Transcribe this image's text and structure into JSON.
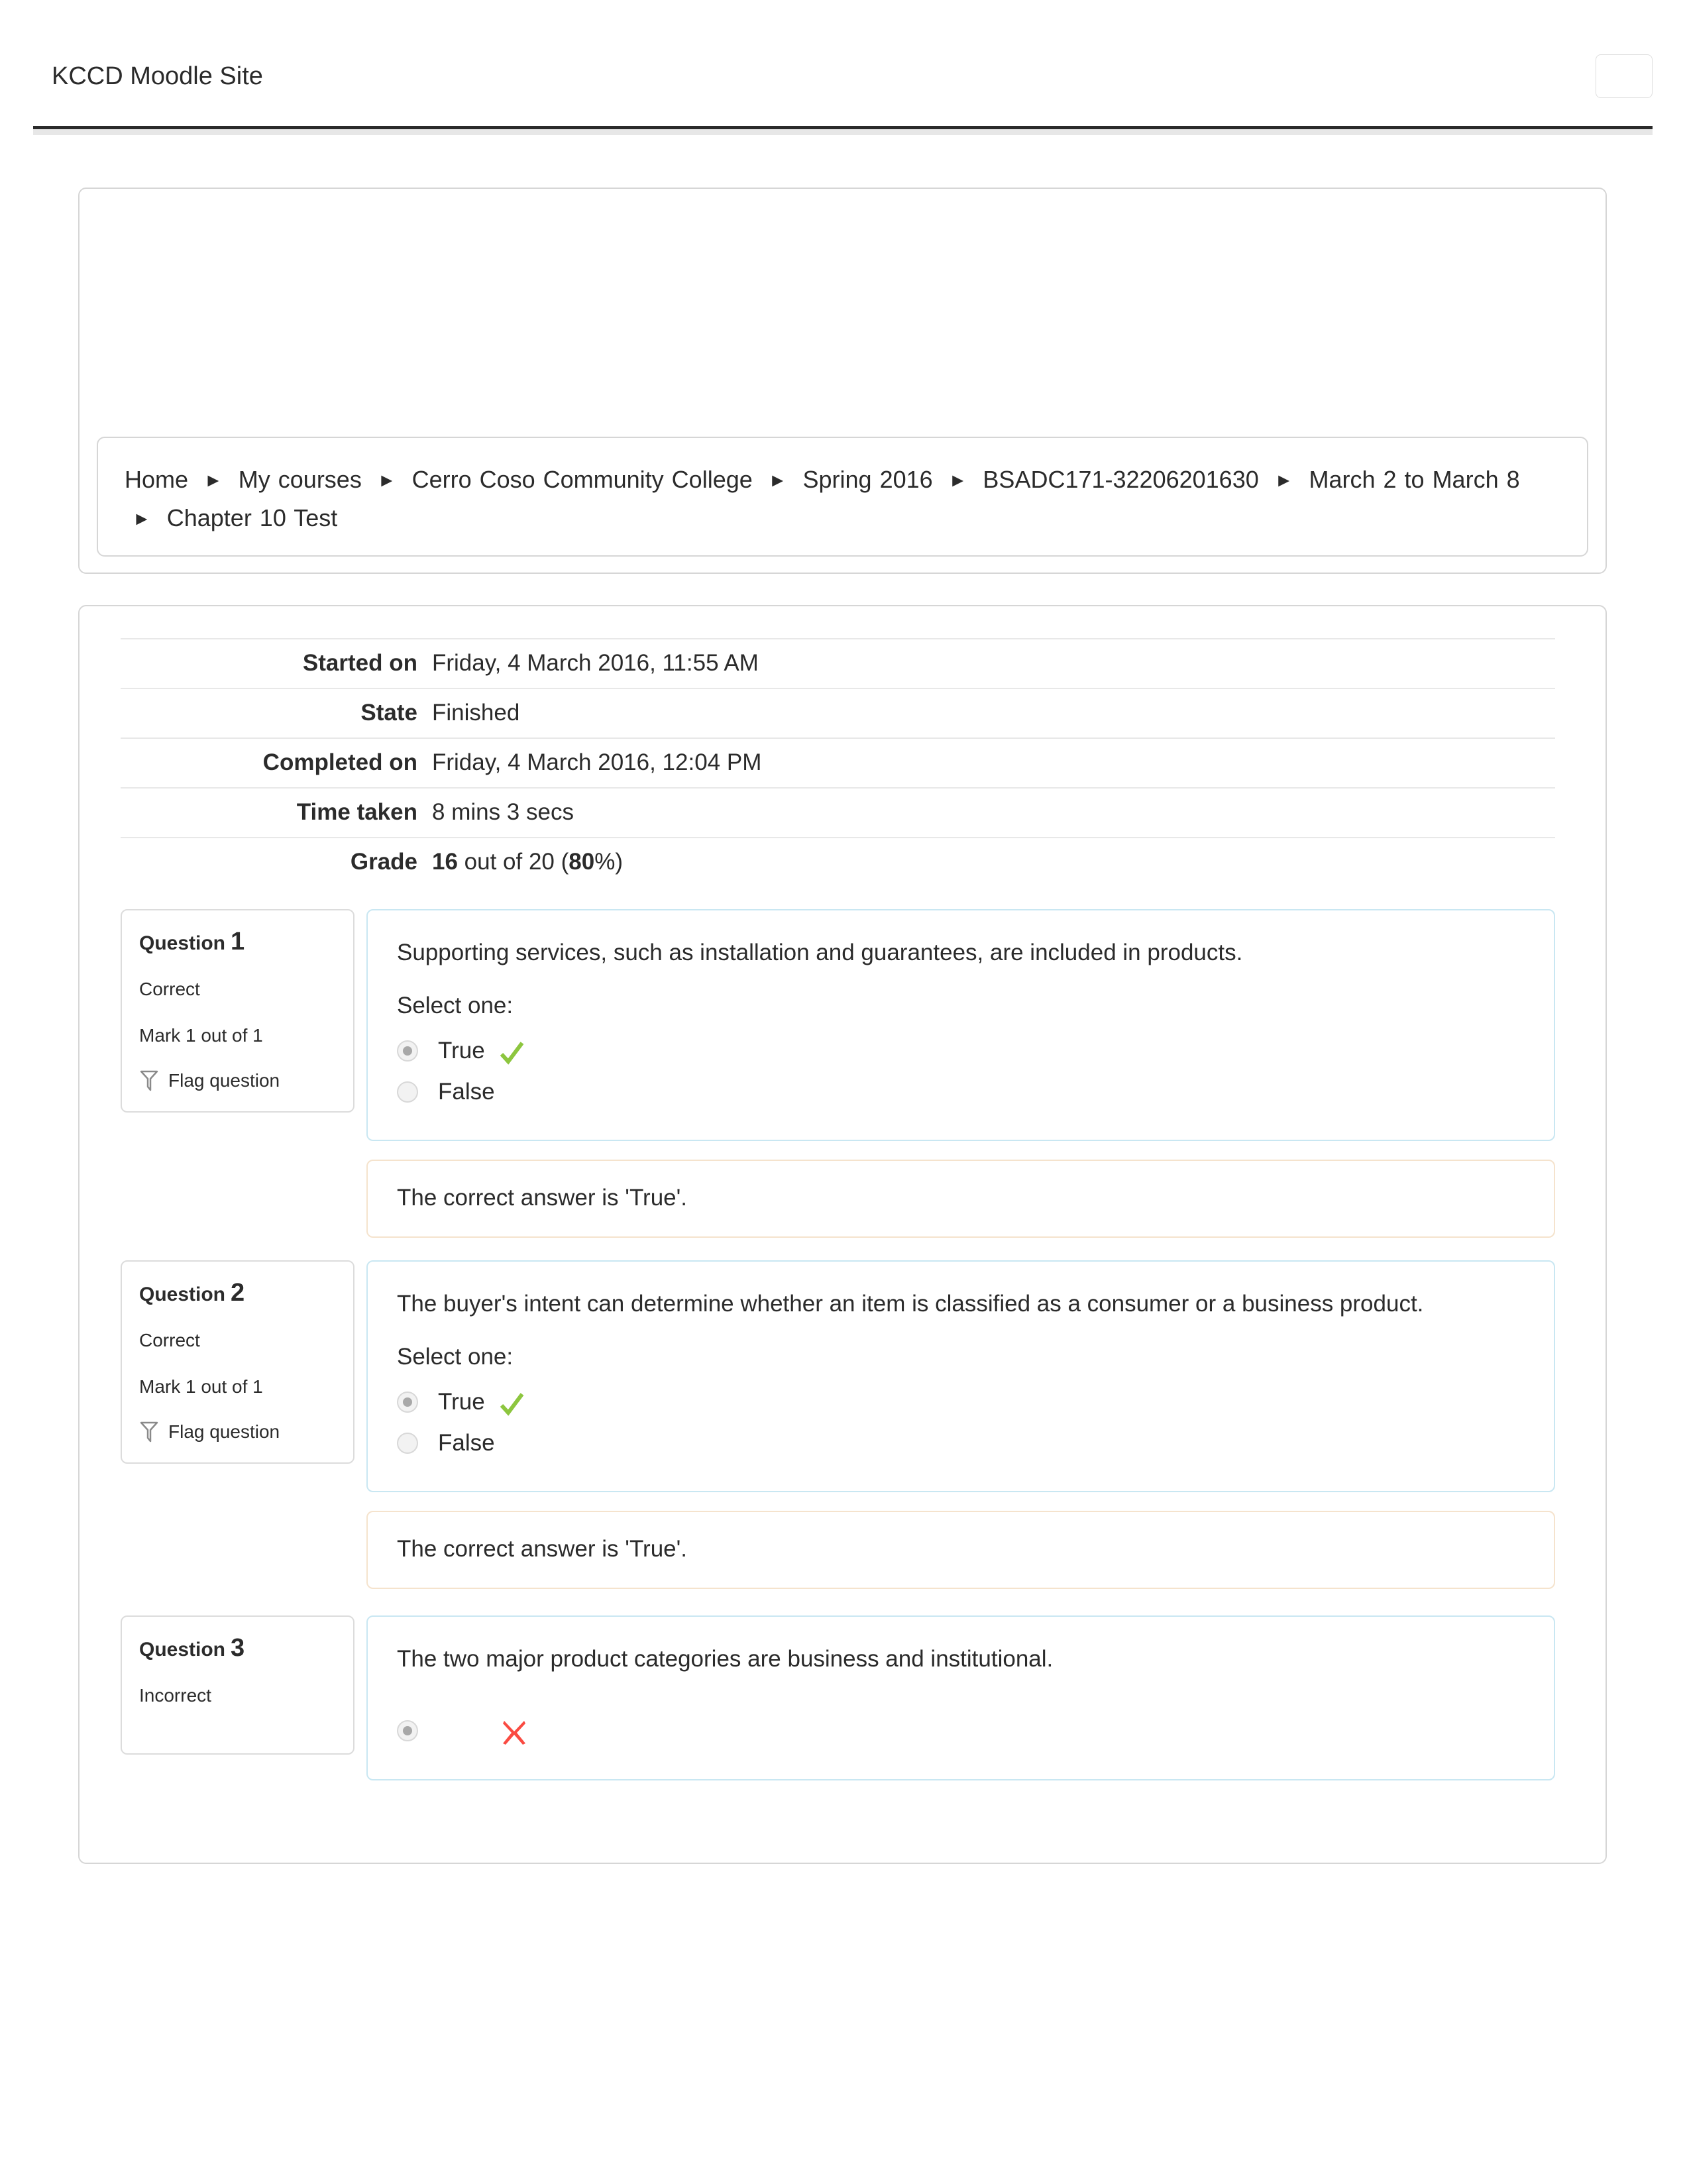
{
  "header": {
    "site_title": "KCCD Moodle Site",
    "menu_button_label": ""
  },
  "breadcrumb": {
    "separator": "►",
    "items": [
      "Home",
      "My courses",
      "Cerro Coso Community College",
      "Spring 2016",
      "BSADC171-32206201630",
      "March 2 to March 8",
      "Chapter 10 Test"
    ]
  },
  "attempt_info": {
    "rows": [
      {
        "label": "Started on",
        "value": "Friday, 4 March 2016, 11:55 AM"
      },
      {
        "label": "State",
        "value": "Finished"
      },
      {
        "label": "Completed on",
        "value": "Friday, 4 March 2016, 12:04 PM"
      },
      {
        "label": "Time taken",
        "value": "8 mins 3 secs"
      }
    ],
    "grade": {
      "label": "Grade",
      "score": "16",
      "middle": " out of 20 (",
      "percent": "80",
      "suffix": "%)"
    }
  },
  "questions": [
    {
      "title": "Question",
      "number": "1",
      "state": "Correct",
      "mark": "Mark 1 out of 1",
      "flag_label": "Flag question",
      "text": "Supporting services, such as installation and guarantees, are included in products.",
      "select_label": "Select one:",
      "answers": [
        {
          "label": "True",
          "selected": true,
          "mark": "correct"
        },
        {
          "label": "False",
          "selected": false,
          "mark": "none"
        }
      ],
      "feedback": "The correct answer is 'True'."
    },
    {
      "title": "Question",
      "number": "2",
      "state": "Correct",
      "mark": "Mark 1 out of 1",
      "flag_label": "Flag question",
      "text": "The buyer's intent can determine whether an item is classified as a consumer or a business product.",
      "select_label": "Select one:",
      "answers": [
        {
          "label": "True",
          "selected": true,
          "mark": "correct"
        },
        {
          "label": "False",
          "selected": false,
          "mark": "none"
        }
      ],
      "feedback": "The correct answer is 'True'."
    },
    {
      "title": "Question",
      "number": "3",
      "state": "Incorrect",
      "mark": "",
      "flag_label": "",
      "text": "The two major product categories are business and institutional.",
      "select_label": "",
      "answers": [
        {
          "label": "",
          "selected": true,
          "mark": "incorrect"
        }
      ],
      "feedback": ""
    }
  ],
  "colors": {
    "correct_green": "#8DC63F",
    "incorrect_red": "#FA4B42",
    "question_border_blue": "#C9E7F2",
    "feedback_border_tan": "#F5E3CD",
    "card_border_gray": "#D6D6D6",
    "header_rule_dark": "#2B2B2B"
  }
}
